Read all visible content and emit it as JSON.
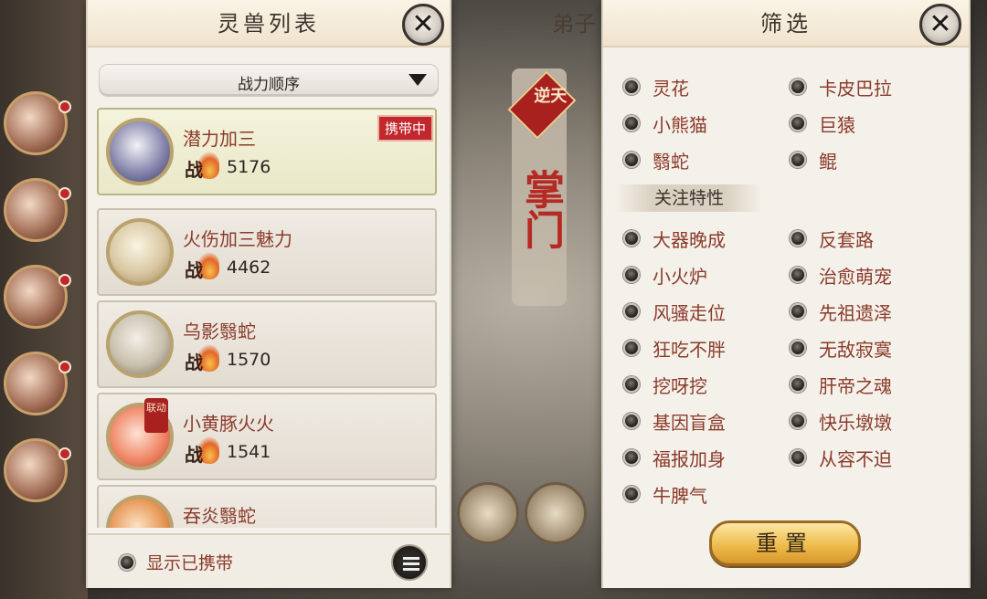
{
  "beast_panel": {
    "title": "灵兽列表",
    "sort_label": "战力顺序",
    "show_carried_label": "显示已携带",
    "items": [
      {
        "name": "潜力加三",
        "power_icon_text": "战",
        "power": "5176",
        "badge": "携带中",
        "avatar_color": "#7e7ea8"
      },
      {
        "name": "火伤加三魅力",
        "power_icon_text": "战",
        "power": "4462",
        "badge": "",
        "avatar_color": "#d9c9a4"
      },
      {
        "name": "乌影翳蛇",
        "power_icon_text": "战",
        "power": "1570",
        "badge": "",
        "avatar_color": "#c9c0ae"
      },
      {
        "name": "小黄豚火火",
        "power_icon_text": "战",
        "power": "1541",
        "badge": "",
        "seal": "联动",
        "avatar_color": "#f08a6a"
      },
      {
        "name": "吞炎翳蛇",
        "power_icon_text": "战",
        "power": "",
        "badge": "",
        "avatar_color": "#e89a5a"
      }
    ]
  },
  "background": {
    "tab_title": "弟子",
    "banner_seal": "逆天",
    "banner_text": "掌门"
  },
  "filter_panel": {
    "title": "筛选",
    "species_left": [
      "灵花",
      "小熊猫",
      "翳蛇"
    ],
    "species_right": [
      "卡皮巴拉",
      "巨猿",
      "鲲"
    ],
    "trait_section_title": "关注特性",
    "traits_left": [
      "大器晚成",
      "小火炉",
      "风骚走位",
      "狂吃不胖",
      "挖呀挖",
      "基因盲盒",
      "福报加身",
      "牛脾气"
    ],
    "traits_right": [
      "反套路",
      "治愈萌宠",
      "先祖遗泽",
      "无敌寂寞",
      "肝帝之魂",
      "快乐墩墩",
      "从容不迫"
    ],
    "reset_label": "重置"
  },
  "icons": {
    "close": "close-icon",
    "dropdown": "dropdown-arrow-icon",
    "list_toggle": "list-icon",
    "power": "power-flame-icon"
  }
}
